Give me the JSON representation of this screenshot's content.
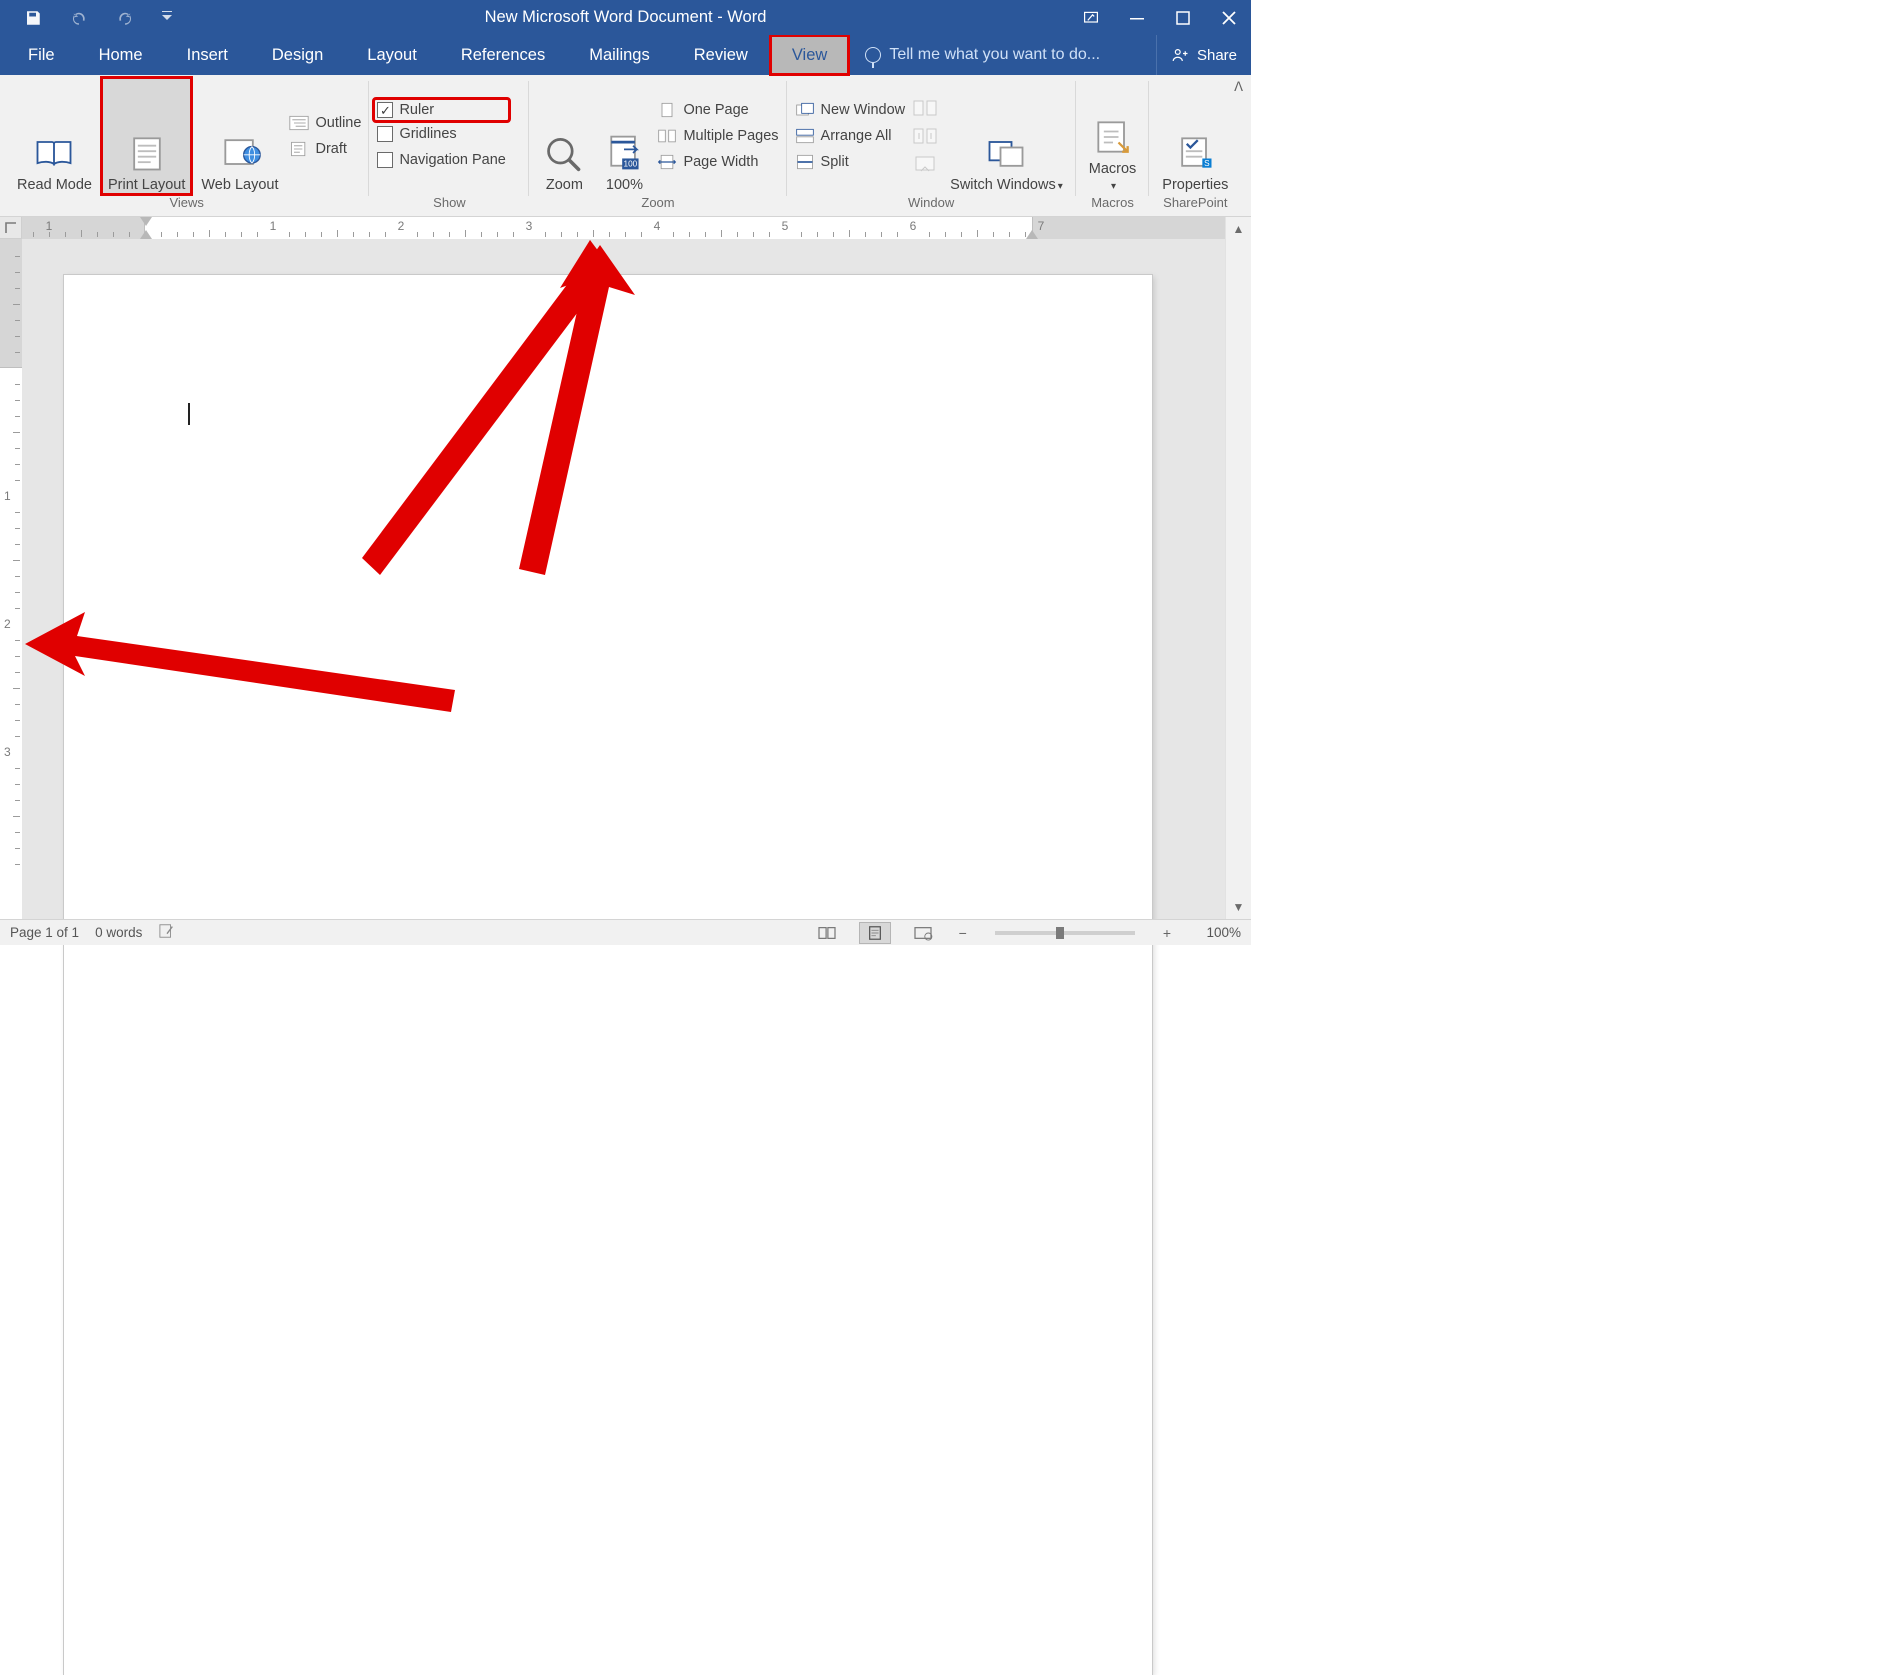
{
  "title": "New Microsoft Word Document - Word",
  "tabs": {
    "file": "File",
    "home": "Home",
    "insert": "Insert",
    "design": "Design",
    "layout": "Layout",
    "references": "References",
    "mailings": "Mailings",
    "review": "Review",
    "view": "View"
  },
  "tellme_placeholder": "Tell me what you want to do...",
  "share_label": "Share",
  "ribbon": {
    "views": {
      "read_mode": "Read Mode",
      "print_layout": "Print Layout",
      "web_layout": "Web Layout",
      "outline": "Outline",
      "draft": "Draft",
      "group_label": "Views"
    },
    "show": {
      "ruler": "Ruler",
      "gridlines": "Gridlines",
      "navigation_pane": "Navigation Pane",
      "group_label": "Show",
      "ruler_checked": true,
      "gridlines_checked": false,
      "navpane_checked": false
    },
    "zoom": {
      "zoom": "Zoom",
      "hundred": "100%",
      "one_page": "One Page",
      "multiple_pages": "Multiple Pages",
      "page_width": "Page Width",
      "group_label": "Zoom"
    },
    "window": {
      "new_window": "New Window",
      "arrange_all": "Arrange All",
      "split": "Split",
      "switch_windows": "Switch Windows",
      "group_label": "Window"
    },
    "macros": {
      "macros": "Macros",
      "group_label": "Macros"
    },
    "sharepoint": {
      "properties": "Properties",
      "group_label": "SharePoint"
    }
  },
  "ruler": {
    "h_numbers": [
      "1",
      "1",
      "2",
      "3",
      "4",
      "5",
      "6",
      "7"
    ],
    "v_numbers": [
      "1",
      "2",
      "3"
    ]
  },
  "status": {
    "page": "Page 1 of 1",
    "words": "0 words",
    "zoom": "100%"
  }
}
